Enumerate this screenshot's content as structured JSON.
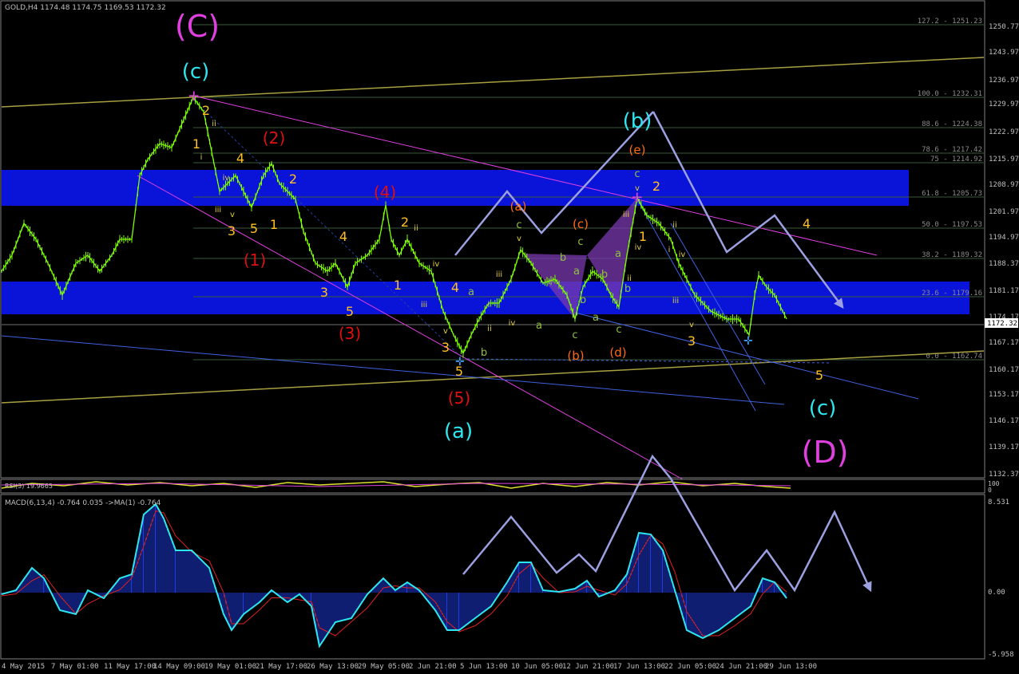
{
  "header": {
    "symbol_label": "GOLD,H4  1174.48  1174.75  1169.53  1172.32"
  },
  "macd_header": {
    "label": "MACD(6,13,4) -0.764 0.035  ->MA(1) -0.764"
  },
  "rsi_header": {
    "label": "RSI(3) 19.9665"
  },
  "current_price": "1172.32",
  "price_axis": {
    "labels": [
      "1250.77",
      "1243.97",
      "1236.97",
      "1229.97",
      "1222.97",
      "1215.97",
      "1208.97",
      "1201.97",
      "1194.97",
      "1188.37",
      "1181.17",
      "1174.17",
      "1167.17",
      "1160.17",
      "1153.17",
      "1146.17",
      "1139.17",
      "1132.37"
    ]
  },
  "macd_axis": {
    "top": "8.531",
    "zero": "0.00",
    "bottom": "-5.958"
  },
  "rsi_axis": {
    "top": "100",
    "bottom": "0"
  },
  "time_axis": {
    "labels": [
      "4 May 2015",
      "7 May 01:00",
      "11 May 17:00",
      "14 May 09:00",
      "19 May 01:00",
      "21 May 17:00",
      "26 May 13:00",
      "29 May 05:00",
      "2 Jun 21:00",
      "5 Jun 13:00",
      "10 Jun 05:00",
      "12 Jun 21:00",
      "17 Jun 13:00",
      "22 Jun 05:00",
      "24 Jun 21:00",
      "29 Jun 13:00"
    ]
  },
  "fib_levels": [
    {
      "label": "127.2 - 1251.23"
    },
    {
      "label": "100.0 - 1232.31"
    },
    {
      "label": "88.6 - 1224.38"
    },
    {
      "label": "78.6 - 1217.42"
    },
    {
      "label": "75 - 1214.92"
    },
    {
      "label": "61.8 - 1205.73"
    },
    {
      "label": "50.0 - 1197.53"
    },
    {
      "label": "38.2 - 1189.32"
    },
    {
      "label": "23.6 - 1179.16"
    },
    {
      "label": "0.0 - 1162.74"
    }
  ],
  "wave_labels": {
    "C_major": "(C)",
    "D_major": "(D)",
    "c_top": "(c)",
    "a_mid": "(a)",
    "b_mid": "(b)",
    "c_bottom": "(c)",
    "w1": "(1)",
    "w2": "(2)",
    "w3": "(3)",
    "w4": "(4)",
    "w5": "(5)",
    "sa": "(a)",
    "sb": "(b)",
    "sc": "(c)",
    "sd": "(d)",
    "se": "(e)",
    "y1": "1",
    "y2": "2",
    "y3": "3",
    "y4": "4",
    "y5": "5",
    "y1b": "1",
    "y2b": "2",
    "y3b": "3",
    "y4b": "4",
    "y5b": "5",
    "y1c": "1",
    "y2c": "2",
    "y3c": "3",
    "y4c": "4",
    "y5c": "5",
    "y1d": "1",
    "y2d": "2",
    "y3d": "3",
    "y4d": "4",
    "y5d": "5",
    "y5e": "5",
    "y3e": "3"
  },
  "colors": {
    "background": "#000000",
    "candle": "#7CFC00",
    "blue_zone": "#0A14D8",
    "magenta": "#E040E0",
    "cyan": "#2EE6F0",
    "red": "#E01010",
    "orange": "#FF6A10",
    "yellow": "#FFC020",
    "arrow": "#9CA0E0",
    "olive": "#A8A040",
    "grid_text": "#C0C0C0"
  }
}
